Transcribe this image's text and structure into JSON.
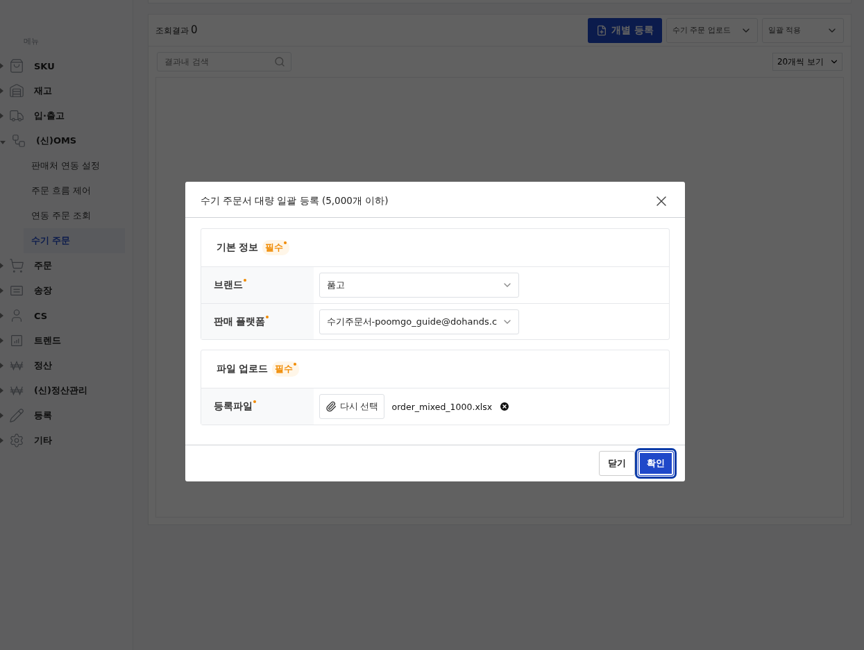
{
  "sidebar": {
    "heading": "메뉴",
    "items": [
      {
        "label": "SKU",
        "expanded": false
      },
      {
        "label": "재고",
        "expanded": false
      },
      {
        "label": "입·출고",
        "expanded": false
      },
      {
        "label": "(신)OMS",
        "expanded": true,
        "children": [
          {
            "label": "판매처 연동 설정",
            "selected": false
          },
          {
            "label": "주문 흐름 제어",
            "selected": false
          },
          {
            "label": "연동 주문 조회",
            "selected": false
          },
          {
            "label": "수기 주문",
            "selected": true
          }
        ]
      },
      {
        "label": "주문",
        "expanded": false
      },
      {
        "label": "송장",
        "expanded": false
      },
      {
        "label": "CS",
        "expanded": false
      },
      {
        "label": "트렌드",
        "expanded": false
      },
      {
        "label": "정산",
        "expanded": false
      },
      {
        "label": "(신)정산관리",
        "expanded": false
      },
      {
        "label": "등록",
        "expanded": false
      },
      {
        "label": "기타",
        "expanded": false
      }
    ]
  },
  "results": {
    "label": "조회결과",
    "count": "0",
    "primary_button": "개별 등록",
    "dropdowns": [
      "수기 주문 업로드",
      "일괄 적용"
    ],
    "search": {
      "placeholder": "결과내 검색"
    },
    "page_size": "20개씩 보기"
  },
  "modal": {
    "title": "수기 주문서 대량 일괄 등록 (5,000개 이하)",
    "sections": [
      {
        "title": "기본 정보",
        "badge": "필수",
        "fields": [
          {
            "kind": "select",
            "label": "브랜드",
            "required": true,
            "value": "품고"
          },
          {
            "kind": "select",
            "label": "판매 플랫폼",
            "required": true,
            "value": "수기주문서-poomgo_guide@dohands.c"
          }
        ]
      },
      {
        "title": "파일 업로드",
        "badge": "필수",
        "fields": [
          {
            "kind": "file",
            "label": "등록파일",
            "required": true,
            "button": "다시 선택",
            "value": "order_mixed_1000.xlsx"
          }
        ]
      }
    ],
    "buttons": [
      {
        "label": "닫기",
        "kind": "secondary",
        "focused": false
      },
      {
        "label": "확인",
        "kind": "primary",
        "focused": true
      }
    ]
  }
}
